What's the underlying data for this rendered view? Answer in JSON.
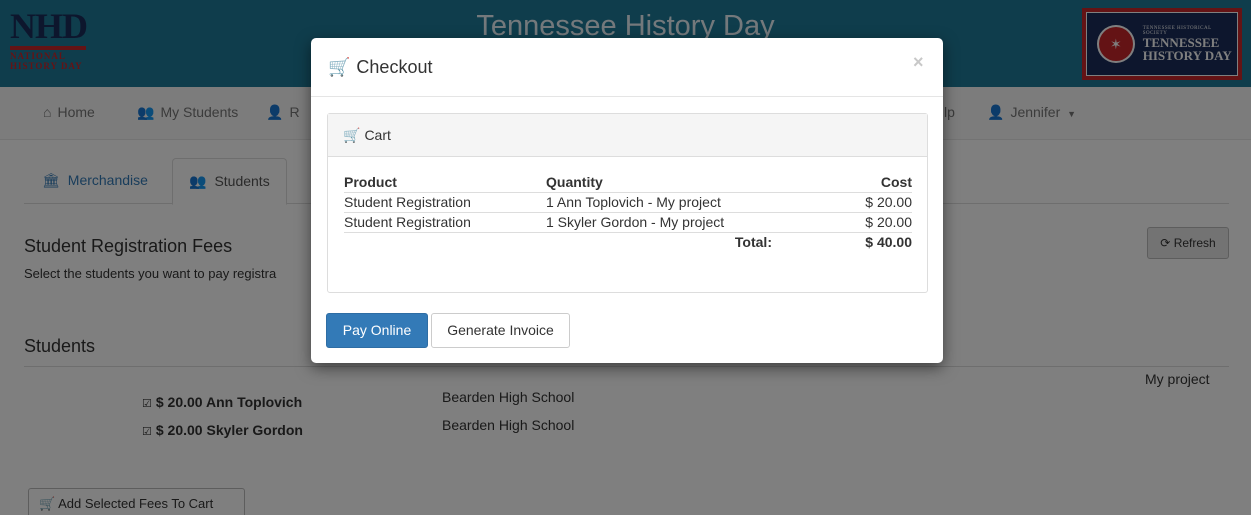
{
  "header": {
    "logo_big": "NHD",
    "logo_small_1": "NATIONAL",
    "logo_small_2": "HISTORY DAY",
    "site_title": "Tennessee History Day",
    "partner_tiny": "TENNESSEE HISTORICAL SOCIETY",
    "partner_line1": "TENNESSEE",
    "partner_line2": "HISTORY DAY"
  },
  "nav": {
    "home": "Home",
    "my_students": "My Students",
    "register_fragment": "R",
    "help_fragment": "lp",
    "user": "Jennifer"
  },
  "tabs": [
    {
      "label": "Merchandise",
      "icon": "store-icon"
    },
    {
      "label": "Students",
      "icon": "users-icon"
    }
  ],
  "page": {
    "fees_heading": "Student Registration Fees",
    "fees_desc": "Select the students you want to pay registra",
    "refresh_label": "Refresh",
    "students_heading": "Students",
    "project_col": "My project",
    "add_to_cart_label": "Add Selected Fees To Cart",
    "students": [
      {
        "fee": "$ 20.00",
        "name": "Ann Toplovich",
        "school": "Bearden High School",
        "checked": true
      },
      {
        "fee": "$ 20.00",
        "name": "Skyler Gordon",
        "school": "Bearden High School",
        "checked": true
      }
    ]
  },
  "modal": {
    "title": "Checkout",
    "close": "×",
    "cart_heading": "Cart",
    "columns": {
      "product": "Product",
      "quantity": "Quantity",
      "cost": "Cost"
    },
    "rows": [
      {
        "product": "Student Registration",
        "quantity": "1 Ann Toplovich - My project",
        "cost": "$ 20.00"
      },
      {
        "product": "Student Registration",
        "quantity": "1 Skyler Gordon - My project",
        "cost": "$ 20.00"
      }
    ],
    "total_label": "Total:",
    "total_value": "$ 40.00",
    "pay_online": "Pay Online",
    "generate_invoice": "Generate Invoice"
  },
  "colors": {
    "banner": "#1f7a99",
    "primary": "#337ab7",
    "nhd_red": "#c9262b",
    "nhd_navy": "#1a2d5a"
  }
}
